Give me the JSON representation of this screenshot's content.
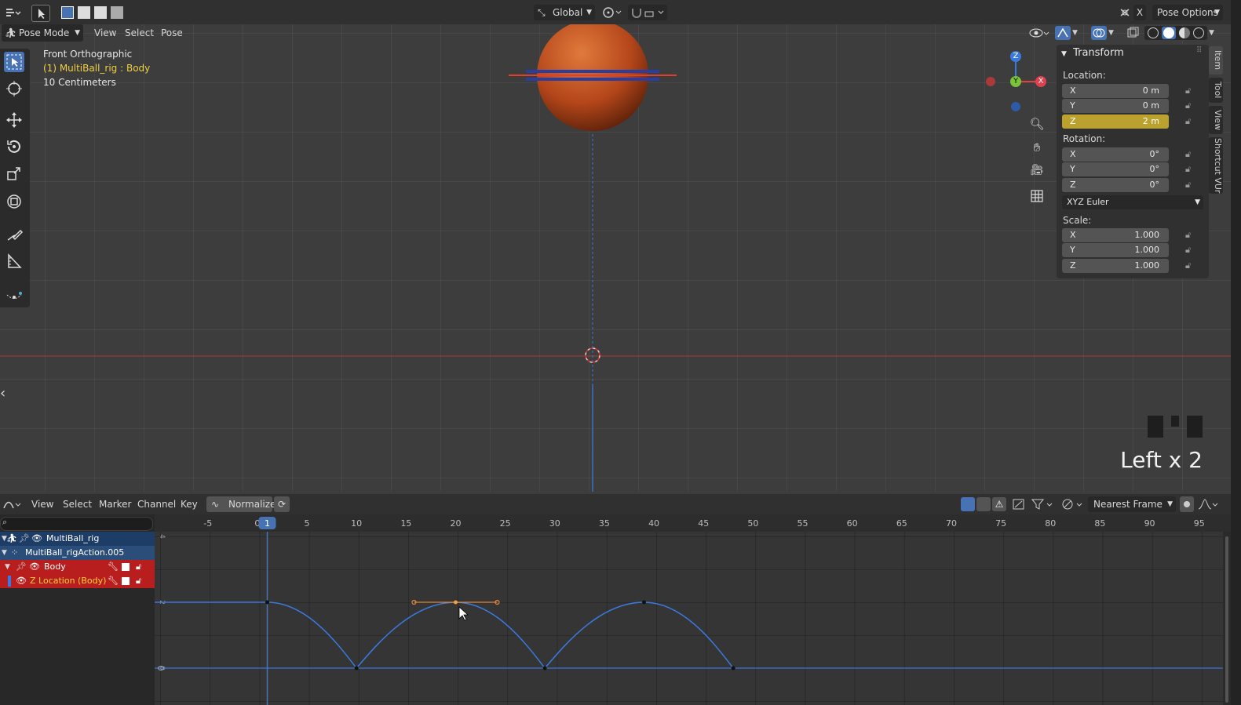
{
  "top_header": {
    "transform_orientation": "Global",
    "pose_options": "Pose Options",
    "x_close": "X"
  },
  "viewport": {
    "mode": "Pose Mode",
    "menus": [
      "View",
      "Select",
      "Pose"
    ],
    "overlay_view_name": "Front Orthographic",
    "overlay_object": "(1) MultiBall_rig : Body",
    "overlay_scale": "10 Centimeters",
    "key_overlay": "Left x 2",
    "gizmo_axes": [
      "Z",
      "Y",
      "X"
    ]
  },
  "n_panel": {
    "section": "Transform",
    "location_label": "Location:",
    "location": [
      {
        "axis": "X",
        "value": "0 m"
      },
      {
        "axis": "Y",
        "value": "0 m"
      },
      {
        "axis": "Z",
        "value": "2 m"
      }
    ],
    "rotation_label": "Rotation:",
    "rotation": [
      {
        "axis": "X",
        "value": "0°"
      },
      {
        "axis": "Y",
        "value": "0°"
      },
      {
        "axis": "Z",
        "value": "0°"
      }
    ],
    "rotation_mode": "XYZ Euler",
    "scale_label": "Scale:",
    "scale": [
      {
        "axis": "X",
        "value": "1.000"
      },
      {
        "axis": "Y",
        "value": "1.000"
      },
      {
        "axis": "Z",
        "value": "1.000"
      }
    ],
    "tabs": [
      "Item",
      "Tool",
      "View",
      "Shortcut VUr"
    ]
  },
  "graph_editor": {
    "menus": [
      "View",
      "Select",
      "Marker",
      "Channel",
      "Key"
    ],
    "normalize": "Normalize",
    "snap": "Nearest Frame",
    "current_frame": "1",
    "frame_ticks": [
      "-5",
      "0",
      "5",
      "10",
      "15",
      "20",
      "25",
      "30",
      "35",
      "40",
      "45",
      "50",
      "55",
      "60",
      "65",
      "70",
      "75",
      "80",
      "85",
      "90",
      "95"
    ],
    "y_ticks": [
      "4",
      "2",
      "0"
    ],
    "channels": [
      {
        "label": "MultiBall_rig"
      },
      {
        "label": "MultiBall_rigAction.005"
      },
      {
        "label": "Body"
      },
      {
        "label": "Z Location (Body)"
      }
    ],
    "keyframes": [
      {
        "frame": 1,
        "value": 2
      },
      {
        "frame": 10,
        "value": 0
      },
      {
        "frame": 20,
        "value": 2
      },
      {
        "frame": 29,
        "value": 0
      },
      {
        "frame": 39,
        "value": 2
      },
      {
        "frame": 48,
        "value": 0
      }
    ],
    "selected_keyframe_frame": 20
  }
}
